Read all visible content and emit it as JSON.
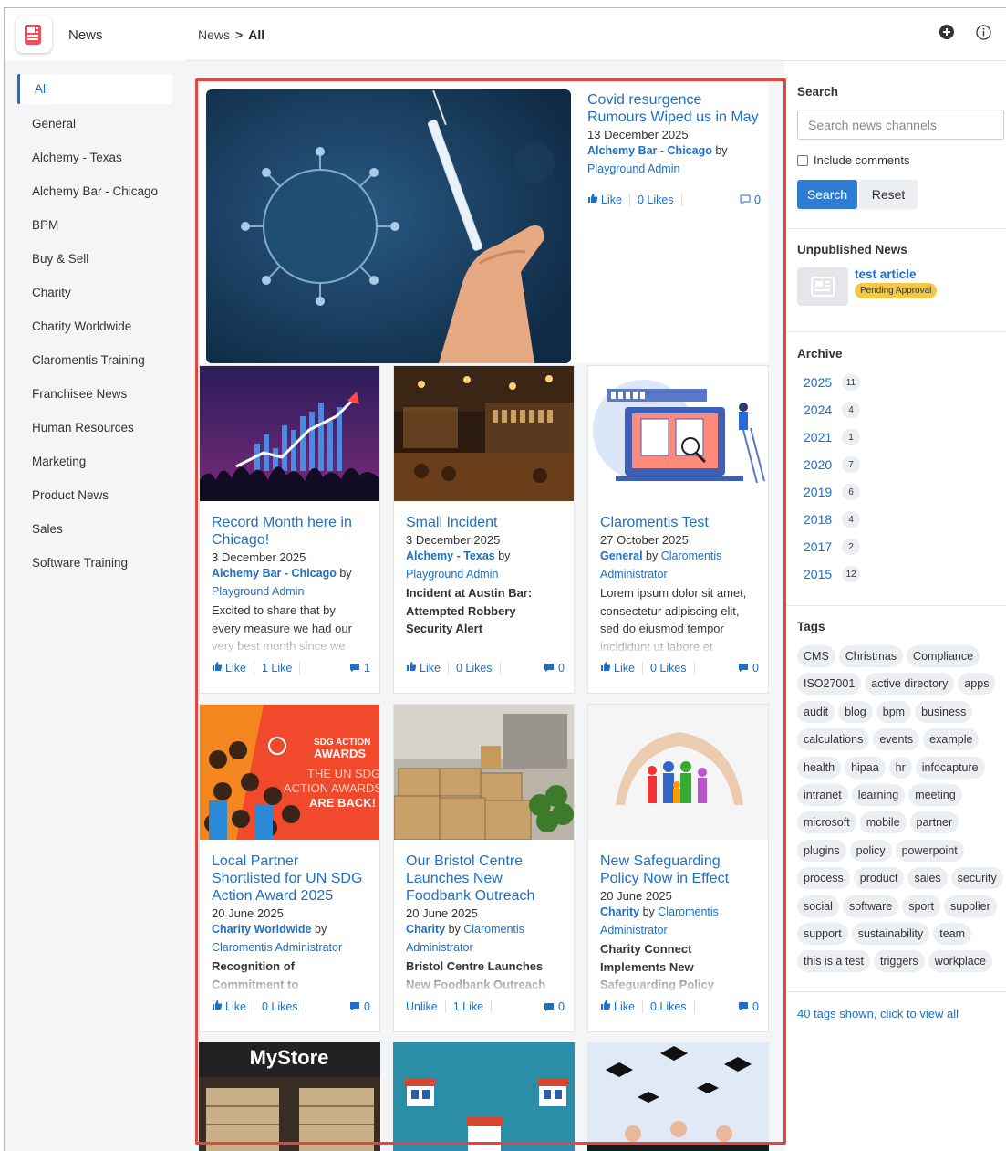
{
  "app": {
    "title": "News"
  },
  "breadcrumb": {
    "root": "News",
    "sep": ">",
    "current": "All"
  },
  "sidebar": {
    "items": [
      {
        "label": "All",
        "active": true
      },
      {
        "label": "General"
      },
      {
        "label": "Alchemy - Texas"
      },
      {
        "label": "Alchemy Bar - Chicago"
      },
      {
        "label": "BPM"
      },
      {
        "label": "Buy & Sell"
      },
      {
        "label": "Charity"
      },
      {
        "label": "Charity Worldwide"
      },
      {
        "label": "Claromentis Training"
      },
      {
        "label": "Franchisee News"
      },
      {
        "label": "Human Resources"
      },
      {
        "label": "Marketing"
      },
      {
        "label": "Product News"
      },
      {
        "label": "Sales"
      },
      {
        "label": "Software Training"
      }
    ]
  },
  "featured": {
    "title": "Covid resurgence Rumours Wiped us in May",
    "date": "13 December 2025",
    "category": "Alchemy Bar - Chicago",
    "by": "by",
    "author": "Playground Admin",
    "like": "Like",
    "likes": "0 Likes",
    "comments": "0"
  },
  "cards": [
    {
      "title": "Record Month here in Chicago!",
      "date": "3 December 2025",
      "category": "Alchemy Bar - Chicago",
      "by": "by",
      "author": "Playground Admin",
      "excerpt": "Excited to share that by every measure we had our very best month since we",
      "like": "Like",
      "likes": "1 Like",
      "comments": "1"
    },
    {
      "title": "Small Incident",
      "date": "3 December 2025",
      "category": "Alchemy - Texas",
      "by": "by",
      "author": "Playground Admin",
      "excerpt": "Incident at Austin Bar: Attempted Robbery Security Alert",
      "like": "Like",
      "likes": "0 Likes",
      "comments": "0"
    },
    {
      "title": "Claromentis Test",
      "date": "27 October 2025",
      "category": "General",
      "by": "by",
      "author": "Claromentis Administrator",
      "excerpt": "Lorem ipsum dolor sit amet, consectetur adipiscing elit, sed do eiusmod tempor incididunt ut labore et",
      "like": "Like",
      "likes": "0 Likes",
      "comments": "0"
    },
    {
      "title": "Local Partner Shortlisted for UN SDG Action Award 2025",
      "date": "20 June 2025",
      "category": "Charity Worldwide",
      "by": "by",
      "author": "Claromentis Administrator",
      "excerpt": "Recognition of Commitment to",
      "like": "Like",
      "likes": "0 Likes",
      "comments": "0"
    },
    {
      "title": "Our Bristol Centre Launches New Foodbank Outreach",
      "date": "20 June 2025",
      "category": "Charity",
      "by": "by",
      "author": "Claromentis Administrator",
      "excerpt": "Bristol Centre Launches New Foodbank Outreach",
      "like": "Unlike",
      "likes": "1 Like",
      "comments": "0"
    },
    {
      "title": "New Safeguarding Policy Now in Effect",
      "date": "20 June 2025",
      "category": "Charity",
      "by": "by",
      "author": "Claromentis Administrator",
      "excerpt": "Charity Connect Implements New Safeguarding Policy",
      "like": "Like",
      "likes": "0 Likes",
      "comments": "0"
    }
  ],
  "image_text": {
    "sdg_line1": "SDG ACTION",
    "sdg_line2": "AWARDS",
    "sdg_line3": "THE UN SDG",
    "sdg_line4": "ACTION AWARDS",
    "sdg_line5": "ARE BACK!",
    "mystore": "MyStore"
  },
  "search": {
    "heading": "Search",
    "placeholder": "Search news channels",
    "include_comments": "Include comments",
    "search_btn": "Search",
    "reset_btn": "Reset"
  },
  "unpublished": {
    "heading": "Unpublished News",
    "title": "test article",
    "status": "Pending Approval"
  },
  "archive": {
    "heading": "Archive",
    "years": [
      {
        "year": "2025",
        "count": "11"
      },
      {
        "year": "2024",
        "count": "4"
      },
      {
        "year": "2021",
        "count": "1"
      },
      {
        "year": "2020",
        "count": "7"
      },
      {
        "year": "2019",
        "count": "6"
      },
      {
        "year": "2018",
        "count": "4"
      },
      {
        "year": "2017",
        "count": "2"
      },
      {
        "year": "2015",
        "count": "12"
      }
    ]
  },
  "tags": {
    "heading": "Tags",
    "items": [
      "CMS",
      "Christmas",
      "Compliance",
      "ISO27001",
      "active directory",
      "apps",
      "audit",
      "blog",
      "bpm",
      "business",
      "calculations",
      "events",
      "example",
      "health",
      "hipaa",
      "hr",
      "infocapture",
      "intranet",
      "learning",
      "meeting",
      "microsoft",
      "mobile",
      "partner",
      "plugins",
      "policy",
      "powerpoint",
      "process",
      "product",
      "sales",
      "security",
      "social",
      "software",
      "sport",
      "supplier",
      "support",
      "sustainability",
      "team",
      "this is a test",
      "triggers",
      "workplace"
    ],
    "footer": "40 tags shown, click to view all"
  },
  "colors": {
    "accent": "#1e6fc5",
    "highlight": "#e2463c",
    "pending": "#f3c846"
  }
}
